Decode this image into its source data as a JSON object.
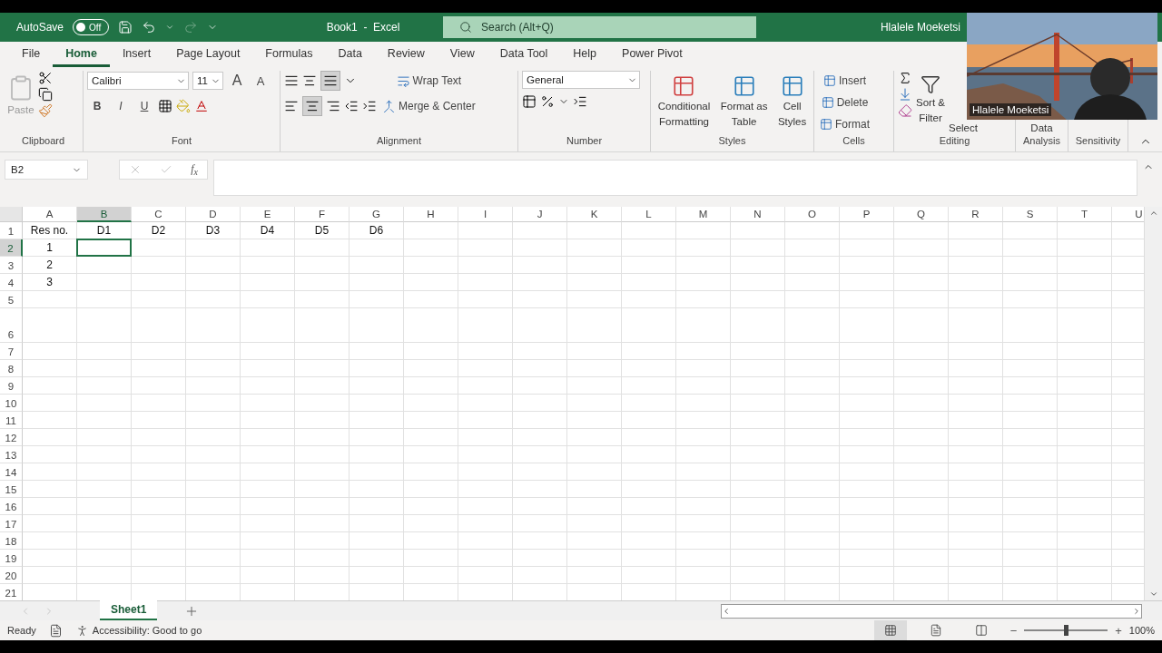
{
  "title_bar": {
    "autosave": {
      "label": "AutoSave",
      "on": false,
      "state": "Off"
    },
    "title": "Book1  -  Excel",
    "search": {
      "placeholder": "Search (Alt+Q)"
    },
    "user": "Hlalele Moeketsi"
  },
  "tabs": [
    {
      "label": "File",
      "selected": false
    },
    {
      "label": "Home",
      "selected": true
    },
    {
      "label": "Insert",
      "selected": false
    },
    {
      "label": "Page Layout",
      "selected": false
    },
    {
      "label": "Formulas",
      "selected": false
    },
    {
      "label": "Data",
      "selected": false
    },
    {
      "label": "Review",
      "selected": false
    },
    {
      "label": "View",
      "selected": false
    },
    {
      "label": "Data Tool",
      "selected": false
    },
    {
      "label": "Help",
      "selected": false
    },
    {
      "label": "Power Pivot",
      "selected": false
    }
  ],
  "ribbon": {
    "clipboard": {
      "paste": "Paste",
      "label": "Clipboard"
    },
    "font": {
      "name": "Calibri",
      "size": "11",
      "label": "Font",
      "grow": "A",
      "shrink": "A",
      "bold": "B",
      "italic": "I",
      "underline": "U"
    },
    "alignment": {
      "wrap": "Wrap Text",
      "merge": "Merge & Center",
      "label": "Alignment"
    },
    "number": {
      "format": "General",
      "label": "Number"
    },
    "styles": {
      "buttons": [
        [
          "Conditional",
          "Formatting"
        ],
        [
          "Format as",
          "Table"
        ],
        [
          "Cell",
          "Styles"
        ]
      ],
      "label": "Styles"
    },
    "cells": {
      "buttons": [
        "Insert",
        "Delete",
        "Format"
      ],
      "label": "Cells"
    },
    "editing": {
      "sort": [
        "Sort &",
        "Filter"
      ],
      "select": "Select",
      "label": "Editing"
    },
    "analysis": {
      "button": "Data",
      "label": "Analysis"
    },
    "sensitivity": {
      "label": "Sensitivity"
    }
  },
  "webcam": {
    "kind": "picture",
    "name": "Hlalele Moeketsi"
  },
  "formula_bar": {
    "name_box": "B2",
    "fx": "f$_{x}$"
  },
  "sheet": {
    "columns": [
      {
        "label": "A",
        "selected": false
      },
      {
        "label": "B",
        "selected": true
      },
      {
        "label": "C",
        "selected": false
      },
      {
        "label": "D",
        "selected": false
      },
      {
        "label": "E",
        "selected": false
      },
      {
        "label": "F",
        "selected": false
      },
      {
        "label": "G",
        "selected": false
      },
      {
        "label": "H",
        "selected": false
      },
      {
        "label": "I",
        "selected": false
      },
      {
        "label": "J",
        "selected": false
      },
      {
        "label": "K",
        "selected": false
      },
      {
        "label": "L",
        "selected": false
      },
      {
        "label": "M",
        "selected": false
      },
      {
        "label": "N",
        "selected": false
      },
      {
        "label": "O",
        "selected": false
      },
      {
        "label": "P",
        "selected": false
      },
      {
        "label": "Q",
        "selected": false
      },
      {
        "label": "R",
        "selected": false
      },
      {
        "label": "S",
        "selected": false
      },
      {
        "label": "T",
        "selected": false
      },
      {
        "label": "U",
        "selected": false
      }
    ],
    "rows": [
      {
        "number": "1",
        "selected": false,
        "tall": false,
        "cells": [
          "Res no.",
          "D1",
          "D2",
          "D3",
          "D4",
          "D5",
          "D6"
        ]
      },
      {
        "number": "2",
        "selected": true,
        "tall": false,
        "cells": [
          "1"
        ]
      },
      {
        "number": "3",
        "selected": false,
        "tall": false,
        "cells": [
          "2"
        ]
      },
      {
        "number": "4",
        "selected": false,
        "tall": false,
        "cells": [
          "3"
        ]
      },
      {
        "number": "5",
        "selected": false,
        "tall": false,
        "cells": []
      },
      {
        "number": "6",
        "selected": false,
        "tall": true,
        "cells": []
      },
      {
        "number": "7",
        "selected": false,
        "tall": false,
        "cells": []
      },
      {
        "number": "8",
        "selected": false,
        "tall": false,
        "cells": []
      },
      {
        "number": "9",
        "selected": false,
        "tall": false,
        "cells": []
      },
      {
        "number": "10",
        "selected": false,
        "tall": false,
        "cells": []
      },
      {
        "number": "11",
        "selected": false,
        "tall": false,
        "cells": []
      },
      {
        "number": "12",
        "selected": false,
        "tall": false,
        "cells": []
      },
      {
        "number": "13",
        "selected": false,
        "tall": false,
        "cells": []
      },
      {
        "number": "14",
        "selected": false,
        "tall": false,
        "cells": []
      },
      {
        "number": "15",
        "selected": false,
        "tall": false,
        "cells": []
      },
      {
        "number": "16",
        "selected": false,
        "tall": false,
        "cells": []
      },
      {
        "number": "17",
        "selected": false,
        "tall": false,
        "cells": []
      },
      {
        "number": "18",
        "selected": false,
        "tall": false,
        "cells": []
      },
      {
        "number": "19",
        "selected": false,
        "tall": false,
        "cells": []
      },
      {
        "number": "20",
        "selected": false,
        "tall": false,
        "cells": []
      },
      {
        "number": "21",
        "selected": false,
        "tall": false,
        "cells": []
      }
    ]
  },
  "sheet_tabs": [
    {
      "label": "Sheet1",
      "selected": true
    }
  ],
  "status_bar": {
    "status": "Ready",
    "accessibility": "Accessibility: Good to go",
    "views": [
      {
        "kind": "normal",
        "selected": true
      },
      {
        "kind": "page_layout",
        "selected": false
      },
      {
        "kind": "page_break",
        "selected": false
      }
    ],
    "zoom": {
      "minus": "−",
      "plus": "+",
      "level": 0.5,
      "reading": "100%"
    }
  }
}
